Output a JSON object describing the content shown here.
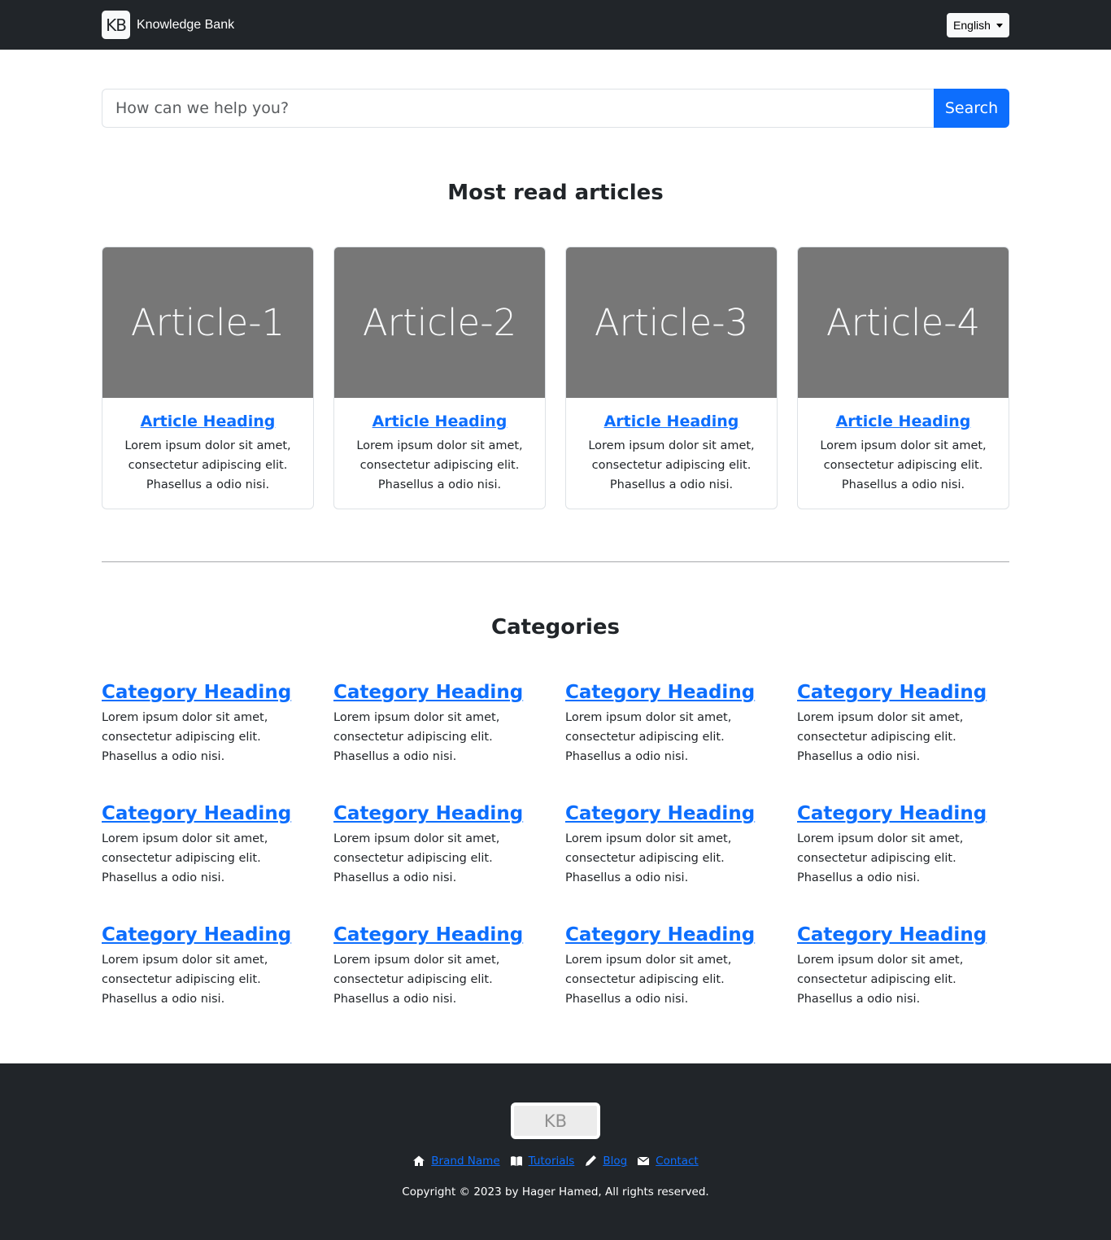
{
  "navbar": {
    "logo_text": "KB",
    "brand_name": "Knowledge Bank",
    "language_label": "English"
  },
  "search": {
    "placeholder": "How can we help you?",
    "button_label": "Search"
  },
  "most_read": {
    "title": "Most read articles",
    "articles": [
      {
        "image_text": "Article-1",
        "heading": "Article Heading",
        "text": "Lorem ipsum dolor sit amet, consectetur adipiscing elit. Phasellus a odio nisi."
      },
      {
        "image_text": "Article-2",
        "heading": "Article Heading",
        "text": "Lorem ipsum dolor sit amet, consectetur adipiscing elit. Phasellus a odio nisi."
      },
      {
        "image_text": "Article-3",
        "heading": "Article Heading",
        "text": "Lorem ipsum dolor sit amet, consectetur adipiscing elit. Phasellus a odio nisi."
      },
      {
        "image_text": "Article-4",
        "heading": "Article Heading",
        "text": "Lorem ipsum dolor sit amet, consectetur adipiscing elit. Phasellus a odio nisi."
      }
    ]
  },
  "categories": {
    "title": "Categories",
    "items": [
      {
        "heading": "Category Heading",
        "text": "Lorem ipsum dolor sit amet, consectetur adipiscing elit. Phasellus a odio nisi."
      },
      {
        "heading": "Category Heading",
        "text": "Lorem ipsum dolor sit amet, consectetur adipiscing elit. Phasellus a odio nisi."
      },
      {
        "heading": "Category Heading",
        "text": "Lorem ipsum dolor sit amet, consectetur adipiscing elit. Phasellus a odio nisi."
      },
      {
        "heading": "Category Heading",
        "text": "Lorem ipsum dolor sit amet, consectetur adipiscing elit. Phasellus a odio nisi."
      },
      {
        "heading": "Category Heading",
        "text": "Lorem ipsum dolor sit amet, consectetur adipiscing elit. Phasellus a odio nisi."
      },
      {
        "heading": "Category Heading",
        "text": "Lorem ipsum dolor sit amet, consectetur adipiscing elit. Phasellus a odio nisi."
      },
      {
        "heading": "Category Heading",
        "text": "Lorem ipsum dolor sit amet, consectetur adipiscing elit. Phasellus a odio nisi."
      },
      {
        "heading": "Category Heading",
        "text": "Lorem ipsum dolor sit amet, consectetur adipiscing elit. Phasellus a odio nisi."
      },
      {
        "heading": "Category Heading",
        "text": "Lorem ipsum dolor sit amet, consectetur adipiscing elit. Phasellus a odio nisi."
      },
      {
        "heading": "Category Heading",
        "text": "Lorem ipsum dolor sit amet, consectetur adipiscing elit. Phasellus a odio nisi."
      },
      {
        "heading": "Category Heading",
        "text": "Lorem ipsum dolor sit amet, consectetur adipiscing elit. Phasellus a odio nisi."
      },
      {
        "heading": "Category Heading",
        "text": "Lorem ipsum dolor sit amet, consectetur adipiscing elit. Phasellus a odio nisi."
      }
    ]
  },
  "footer": {
    "logo_text": "KB",
    "links": [
      {
        "icon": "home-icon",
        "label": "Brand Name"
      },
      {
        "icon": "book-icon",
        "label": "Tutorials"
      },
      {
        "icon": "pencil-icon",
        "label": "Blog"
      },
      {
        "icon": "envelope-icon",
        "label": "Contact"
      }
    ],
    "copyright": "Copyright © 2023 by Hager Hamed, All rights reserved."
  },
  "colors": {
    "navbar_bg": "#212529",
    "link": "#0d6efd",
    "primary_button": "#0d6efd",
    "article_image_bg": "#777777"
  }
}
